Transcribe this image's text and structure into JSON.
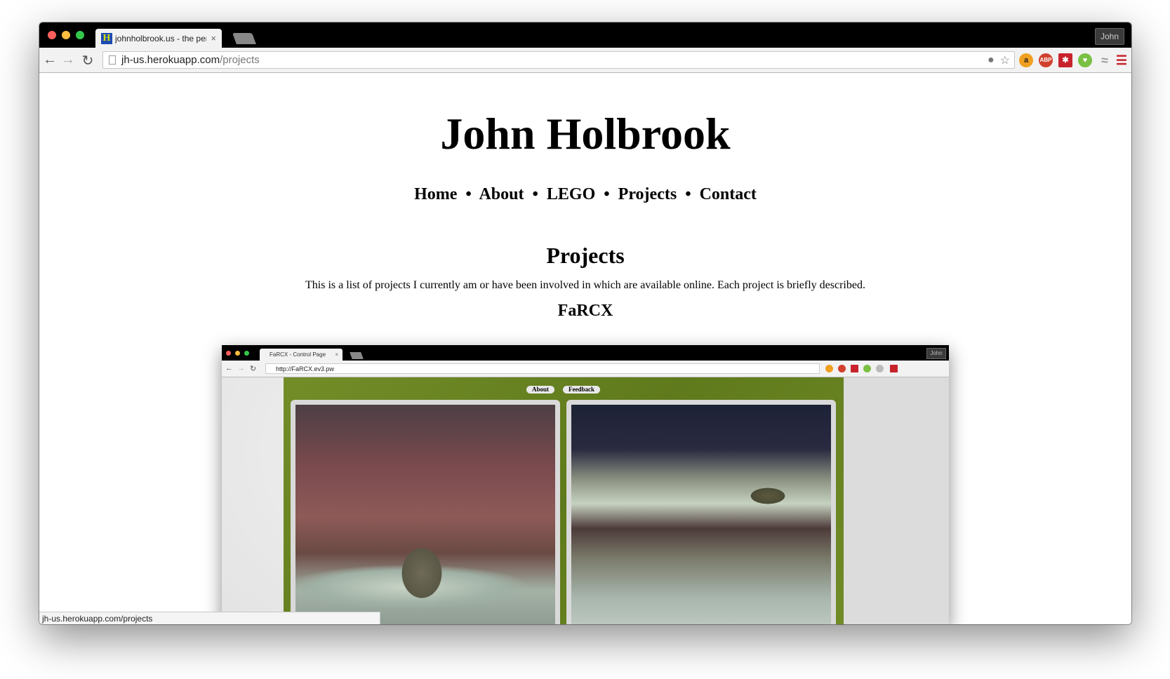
{
  "browser": {
    "tab_title": "johnholbrook.us - the pers",
    "tab_close": "×",
    "favicon_letter": "H",
    "profile_name": "John",
    "url_host": "jh-us.herokuapp.com",
    "url_path": "/projects",
    "status_url": "jh-us.herokuapp.com/projects",
    "extensions": [
      "amazon-icon",
      "adblock-plus-icon",
      "lastpass-icon",
      "evernote-icon",
      "pocket-icon",
      "menu-icon"
    ]
  },
  "page": {
    "site_title": "John Holbrook",
    "nav": [
      {
        "label": "Home"
      },
      {
        "label": "About"
      },
      {
        "label": "LEGO"
      },
      {
        "label": "Projects"
      },
      {
        "label": "Contact"
      }
    ],
    "nav_separator": "•",
    "section_title": "Projects",
    "intro": "This is a list of projects I currently am or have been involved in which are available online. Each project is briefly described.",
    "project_title": "FaRCX"
  },
  "screenshot": {
    "tab_title": "FaRCX - Control Page",
    "tab_close": "×",
    "profile_name": "John",
    "url": "http://FaRCX.ev3.pw",
    "buttons": [
      "About",
      "Feedback"
    ]
  },
  "colors": {
    "farcx_green": "#6b8423",
    "abp_red": "#d1402d",
    "lastpass_red": "#c8232c",
    "evernote_green": "#7ac043"
  }
}
